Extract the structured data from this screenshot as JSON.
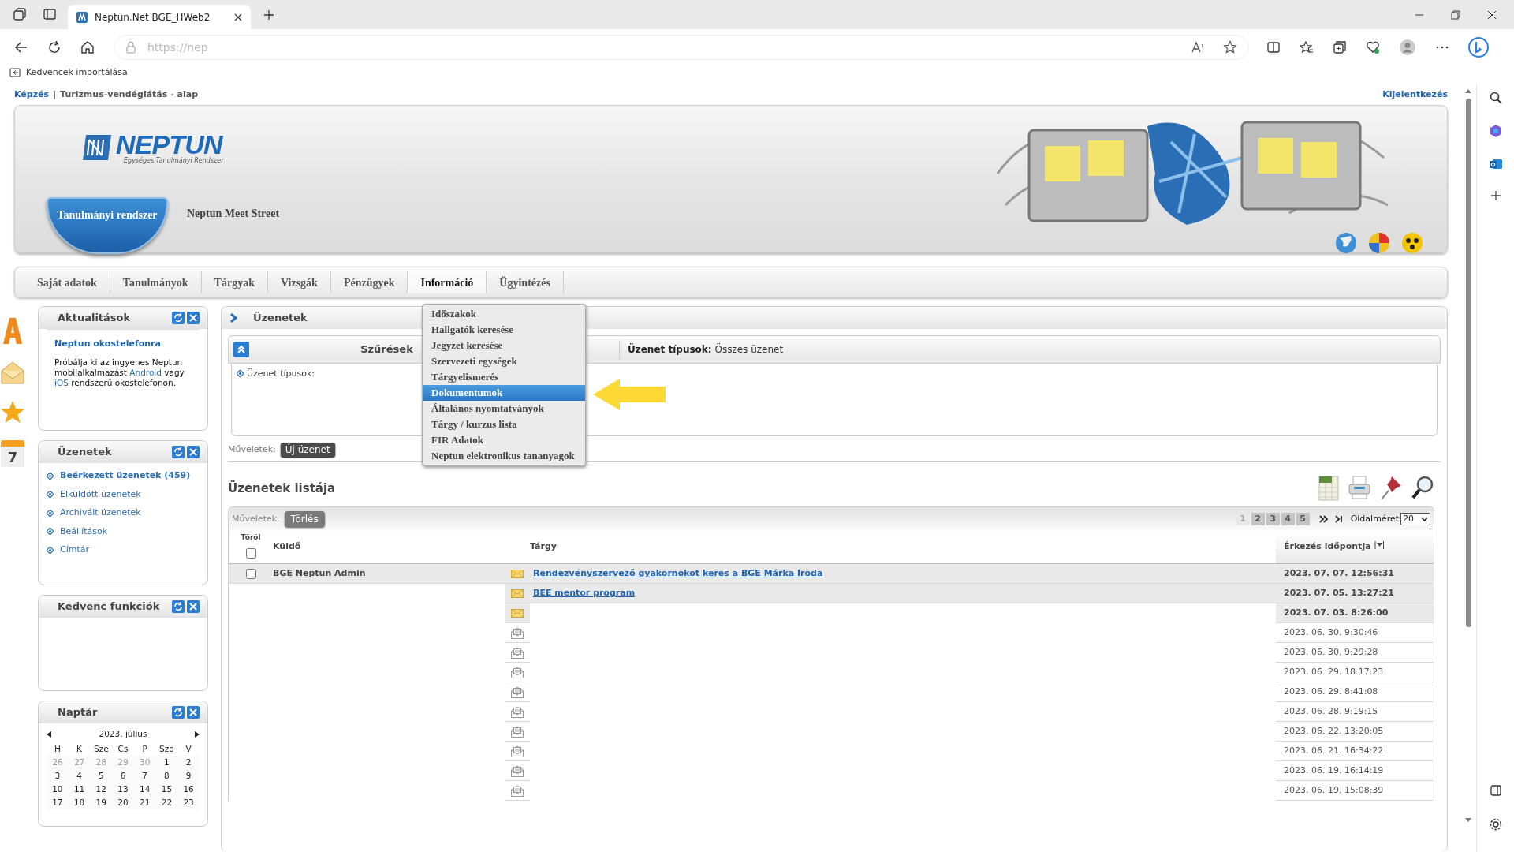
{
  "browser": {
    "tab_title": "Neptun.Net BGE_HWeb2",
    "address": "https://nep",
    "favorites": [
      "Kedvencek importálása"
    ]
  },
  "top_links": {
    "breadcrumb": [
      "Képzés",
      "|",
      "Turizmus-vendéglátás - alap"
    ],
    "logout": "Kijelentkezés"
  },
  "header": {
    "logo": "NEPTUN",
    "logo_subtitle": "Egységes Tanulmányi Rendszer",
    "systems": [
      {
        "label": "Tanulmányi rendszer",
        "selected": true
      },
      {
        "label": "Neptun Meet Street",
        "selected": false
      }
    ]
  },
  "menu": [
    {
      "label": "Saját adatok",
      "selected": false
    },
    {
      "label": "Tanulmányok",
      "selected": false
    },
    {
      "label": "Tárgyak",
      "selected": false
    },
    {
      "label": "Vizsgák",
      "selected": false
    },
    {
      "label": "Pénzügyek",
      "selected": false
    },
    {
      "label": "Információ",
      "selected": true
    },
    {
      "label": "Ügyintézés",
      "selected": false
    }
  ],
  "dropdown": [
    {
      "label": "Időszakok",
      "selected": false
    },
    {
      "label": "Hallgatók keresése",
      "selected": false
    },
    {
      "label": "Jegyzet keresése",
      "selected": false
    },
    {
      "label": "Szervezeti egységek",
      "selected": false
    },
    {
      "label": "Tárgyelismerés",
      "selected": false
    },
    {
      "label": "Dokumentumok",
      "selected": true
    },
    {
      "label": "Általános nyomtatványok",
      "selected": false
    },
    {
      "label": "Tárgy / kurzus lista",
      "selected": false
    },
    {
      "label": "FIR Adatok",
      "selected": false
    },
    {
      "label": "Neptun elektronikus tananyagok",
      "selected": false
    }
  ],
  "side_icons": {
    "calendar_day": "7"
  },
  "sidebar": [
    {
      "kind": "news",
      "title": "Aktualitások",
      "heading": "Neptun okostelefonra",
      "parts": [
        {
          "text": "Próbálja ki az ingyenes Neptun mobilalkalmazást ",
          "link": false
        },
        {
          "text": "Android",
          "link": true
        },
        {
          "text": " vagy ",
          "link": false
        },
        {
          "text": "iOS",
          "link": true
        },
        {
          "text": " rendszerű okostelefonon.",
          "link": false
        }
      ]
    },
    {
      "kind": "links",
      "title": "Üzenetek",
      "items": [
        {
          "label": "Beérkezett üzenetek (459)",
          "selected": true
        },
        {
          "label": "Elküldött üzenetek",
          "selected": false
        },
        {
          "label": "Archivált üzenetek",
          "selected": false
        },
        {
          "label": "Beállítások",
          "selected": false
        },
        {
          "label": "Címtár",
          "selected": false
        }
      ]
    },
    {
      "kind": "empty",
      "title": "Kedvenc funkciók"
    },
    {
      "kind": "calendar",
      "title": "Naptár",
      "month": "2023. július",
      "weekdays": [
        "H",
        "K",
        "Sze",
        "Cs",
        "P",
        "Szo",
        "V"
      ],
      "weeks": [
        [
          {
            "day": "26",
            "other_month": true
          },
          {
            "day": "27",
            "other_month": true
          },
          {
            "day": "28",
            "other_month": true
          },
          {
            "day": "29",
            "other_month": true
          },
          {
            "day": "30",
            "other_month": true
          },
          {
            "day": "1",
            "other_month": false
          },
          {
            "day": "2",
            "other_month": false
          }
        ],
        [
          {
            "day": "3",
            "other_month": false
          },
          {
            "day": "4",
            "other_month": false
          },
          {
            "day": "5",
            "other_month": false
          },
          {
            "day": "6",
            "other_month": false
          },
          {
            "day": "7",
            "other_month": false
          },
          {
            "day": "8",
            "other_month": false
          },
          {
            "day": "9",
            "other_month": false
          }
        ],
        [
          {
            "day": "10",
            "other_month": false
          },
          {
            "day": "11",
            "other_month": false
          },
          {
            "day": "12",
            "other_month": false
          },
          {
            "day": "13",
            "other_month": false
          },
          {
            "day": "14",
            "other_month": false
          },
          {
            "day": "15",
            "other_month": false
          },
          {
            "day": "16",
            "other_month": false
          }
        ],
        [
          {
            "day": "17",
            "other_month": false
          },
          {
            "day": "18",
            "other_month": false
          },
          {
            "day": "19",
            "other_month": false
          },
          {
            "day": "20",
            "other_month": false
          },
          {
            "day": "21",
            "other_month": false
          },
          {
            "day": "22",
            "other_month": false
          },
          {
            "day": "23",
            "other_month": false
          }
        ]
      ]
    }
  ],
  "main": {
    "title": "Üzenetek",
    "filter": {
      "title": "Szűrések",
      "summary_label": "Üzenet típusok:",
      "summary_value": "Összes üzenet",
      "field_label": "Üzenet típusok:"
    },
    "actions_label": "Műveletek:",
    "new_button": "Új üzenet",
    "list": {
      "title": "Üzenetek listája",
      "actions_label": "Műveletek:",
      "delete_button": "Törlés",
      "pages": [
        {
          "label": "1",
          "selected": true
        },
        {
          "label": "2",
          "selected": false
        },
        {
          "label": "3",
          "selected": false
        },
        {
          "label": "4",
          "selected": false
        },
        {
          "label": "5",
          "selected": false
        }
      ],
      "page_size_label": "Oldalméret",
      "page_size": "20",
      "columns": {
        "delete": "Töröl",
        "sender": "Küldő",
        "subject": "Tárgy",
        "date": "Érkezés időpontja"
      },
      "select_all_checked": false,
      "rows": [
        {
          "checked": false,
          "sender": "BGE Neptun Admin",
          "subject": "Rendezvényszervező gyakornokot keres a BGE Márka Iroda",
          "date": "2023. 07. 07. 12:56:31",
          "read": false
        },
        {
          "subject": "BEE mentor program",
          "date": "2023. 07. 05. 13:27:21",
          "read": false
        },
        {
          "date": "2023. 07. 03. 8:26:00",
          "read": false
        },
        {
          "date": "2023. 06. 30. 9:30:46",
          "read": true
        },
        {
          "date": "2023. 06. 30. 9:29:28",
          "read": true
        },
        {
          "date": "2023. 06. 29. 18:17:23",
          "read": true
        },
        {
          "date": "2023. 06. 29. 8:41:08",
          "read": true
        },
        {
          "date": "2023. 06. 28. 9:19:15",
          "read": true
        },
        {
          "date": "2023. 06. 22. 13:20:05",
          "read": true
        },
        {
          "date": "2023. 06. 21. 16:34:22",
          "read": true
        },
        {
          "date": "2023. 06. 19. 16:14:19",
          "read": true
        },
        {
          "date": "2023. 06. 19. 15:08:39",
          "read": true
        }
      ]
    }
  }
}
